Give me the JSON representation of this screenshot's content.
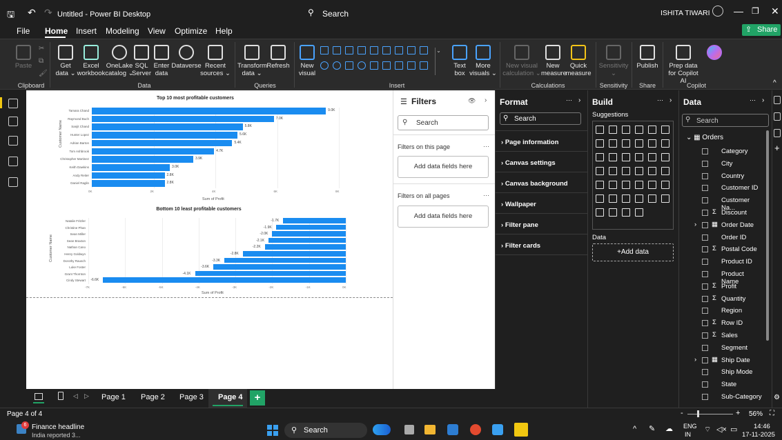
{
  "titlebar": {
    "title": "Untitled - Power BI Desktop",
    "search": "Search",
    "user": "ISHITA TIWARI"
  },
  "menu": [
    "File",
    "Home",
    "Insert",
    "Modeling",
    "View",
    "Optimize",
    "Help"
  ],
  "share_label": "Share",
  "ribbon": {
    "paste": "Paste",
    "get_data": "Get data ⌄",
    "excel": "Excel workbook",
    "onelake": "OneLake catalog ⌄",
    "sql": "SQL Server",
    "enter": "Enter data",
    "dataverse": "Dataverse",
    "recent": "Recent sources ⌄",
    "transform": "Transform data ⌄",
    "refresh": "Refresh",
    "new_visual": "New visual",
    "text_box": "Text box",
    "more_visuals": "More visuals ⌄",
    "new_visual_calc": "New visual calculation ⌄",
    "new_measure": "New measure",
    "quick_measure": "Quick measure",
    "sensitivity": "Sensitivity ⌄",
    "publish": "Publish",
    "copilot_prep": "Prep data for Copilot AI",
    "groups": [
      "Clipboard",
      "Data",
      "Queries",
      "Insert",
      "Calculations",
      "Sensitivity",
      "Share",
      "Copilot"
    ]
  },
  "chart_data": [
    {
      "type": "bar",
      "title": "Top 10 most profitable customers",
      "xlabel": "Sum of Profit",
      "ylabel": "Customer Name",
      "categories": [
        "Tamara Chand",
        "Raymond Buch",
        "Sanjit Chand",
        "Hunter Lopez",
        "Adrian Barton",
        "Tom Ashbrook",
        "Christopher Martinez",
        "Keith Dawkins",
        "Andy Reiter",
        "Daniel Raglin"
      ],
      "values": [
        9.0,
        7.0,
        5.8,
        5.6,
        5.4,
        4.7,
        3.9,
        3.0,
        2.8,
        2.8
      ],
      "labels": [
        "9.0K",
        "7.0K",
        "5.8K",
        "5.6K",
        "5.4K",
        "4.7K",
        "3.9K",
        "3.0K",
        "2.8K",
        "2.8K"
      ],
      "xticks": [
        "0K",
        "2K",
        "4K",
        "6K",
        "8K"
      ],
      "xlim": [
        0,
        9.5
      ]
    },
    {
      "type": "bar",
      "title": "Bottom 10 least profitable customers",
      "xlabel": "Sum of Profit",
      "ylabel": "Customer Name",
      "categories": [
        "Natalie Fritzler",
        "Christine Phan",
        "Sean Miller",
        "Sean Braxton",
        "Nathan Cano",
        "Henry Goldwyn",
        "Dorothy Rausch",
        "Luke Foster",
        "Grant Thornton",
        "Cindy Stewart"
      ],
      "values": [
        -1.7,
        -1.9,
        -2.0,
        -2.1,
        -2.2,
        -2.8,
        -3.3,
        -3.6,
        -4.1,
        -6.6
      ],
      "labels": [
        "-1.7K",
        "-1.9K",
        "-2.0K",
        "-2.1K",
        "-2.2K",
        "-2.8K",
        "-3.3K",
        "-3.6K",
        "-4.1K",
        "-6.6K"
      ],
      "xticks": [
        "-7K",
        "-6K",
        "-5K",
        "-4K",
        "-3K",
        "-2K",
        "-1K",
        "0K"
      ],
      "xlim": [
        -7,
        0
      ]
    }
  ],
  "filters": {
    "title": "Filters",
    "search": "Search",
    "on_page": "Filters on this page",
    "on_all": "Filters on all pages",
    "add_fields": "Add data fields here"
  },
  "format": {
    "title": "Format",
    "search": "Search",
    "items": [
      "Page information",
      "Canvas settings",
      "Canvas background",
      "Wallpaper",
      "Filter pane",
      "Filter cards"
    ]
  },
  "build": {
    "title": "Build",
    "suggestions": "Suggestions",
    "data": "Data",
    "add_data": "+Add data"
  },
  "data_pane": {
    "title": "Data",
    "search": "Search",
    "table": "Orders",
    "fields": [
      {
        "name": "Category",
        "sigma": false,
        "expand": false
      },
      {
        "name": "City",
        "sigma": false,
        "expand": false
      },
      {
        "name": "Country",
        "sigma": false,
        "expand": false
      },
      {
        "name": "Customer ID",
        "sigma": false,
        "expand": false
      },
      {
        "name": "Customer Na...",
        "sigma": false,
        "expand": false
      },
      {
        "name": "Discount",
        "sigma": true,
        "expand": false
      },
      {
        "name": "Order Date",
        "sigma": false,
        "expand": true
      },
      {
        "name": "Order ID",
        "sigma": false,
        "expand": false
      },
      {
        "name": "Postal Code",
        "sigma": true,
        "expand": false
      },
      {
        "name": "Product ID",
        "sigma": false,
        "expand": false
      },
      {
        "name": "Product Name",
        "sigma": false,
        "expand": false
      },
      {
        "name": "Profit",
        "sigma": true,
        "expand": false
      },
      {
        "name": "Quantity",
        "sigma": true,
        "expand": false
      },
      {
        "name": "Region",
        "sigma": false,
        "expand": false
      },
      {
        "name": "Row ID",
        "sigma": true,
        "expand": false
      },
      {
        "name": "Sales",
        "sigma": true,
        "expand": false
      },
      {
        "name": "Segment",
        "sigma": false,
        "expand": false
      },
      {
        "name": "Ship Date",
        "sigma": false,
        "expand": true
      },
      {
        "name": "Ship Mode",
        "sigma": false,
        "expand": false
      },
      {
        "name": "State",
        "sigma": false,
        "expand": false
      },
      {
        "name": "Sub-Category",
        "sigma": false,
        "expand": false
      }
    ]
  },
  "pages": [
    "Page 1",
    "Page 2",
    "Page 3",
    "Page 4"
  ],
  "active_page": "Page 4",
  "status": {
    "page": "Page 4 of 4",
    "zoom": "56%"
  },
  "taskbar": {
    "news_title": "Finance headline",
    "news_sub": "India reported 3...",
    "badge": "6",
    "search": "Search",
    "lang1": "ENG",
    "lang2": "IN",
    "time": "14:46",
    "date": "17-11-2025"
  },
  "colors": {
    "bar": "#1a8cf0",
    "accent": "#21a366"
  }
}
